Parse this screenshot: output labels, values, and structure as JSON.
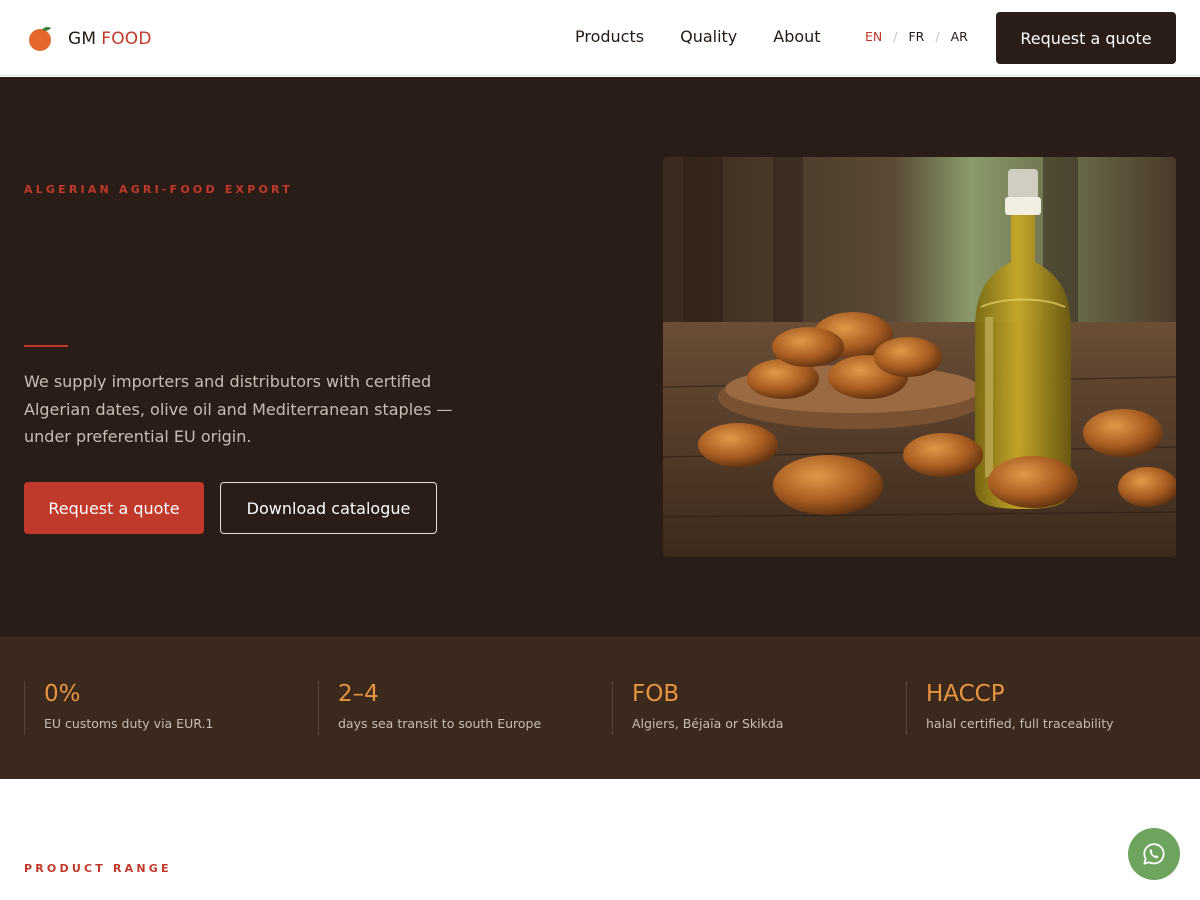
{
  "brand": {
    "name_primary": "GM",
    "name_accent": "FOOD",
    "logo_icon": "orange-fruit-icon"
  },
  "nav": {
    "items": [
      "Products",
      "Quality",
      "About"
    ]
  },
  "languages": {
    "options": [
      "EN",
      "FR",
      "AR"
    ],
    "selected": "EN",
    "separator": "/"
  },
  "header": {
    "cta_label": "Request a quote"
  },
  "hero": {
    "eyebrow": "ALGERIAN AGRI-FOOD EXPORT",
    "description": "We supply importers and distributors with certified Algerian dates, olive oil and Mediterranean staples — under preferential EU origin.",
    "primary_cta": "Request a quote",
    "secondary_cta": "Download catalogue",
    "image_subject": "dates-and-olive-oil-photo"
  },
  "stats": [
    {
      "value": "0%",
      "label": "EU customs duty via EUR.1"
    },
    {
      "value": "2–4",
      "label": "days sea transit to south Europe"
    },
    {
      "value": "FOB",
      "label": "Algiers, Béjaïa or Skikda"
    },
    {
      "value": "HACCP",
      "label": "halal certified, full traceability"
    }
  ],
  "product_range": {
    "eyebrow": "PRODUCT RANGE"
  },
  "floating": {
    "icon": "whatsapp-icon"
  },
  "colors": {
    "accent": "#c0392b",
    "dark": "#2a1d17",
    "stats_bg": "#3b291e",
    "stat_value": "#e8943f",
    "whatsapp": "#6ea55e"
  }
}
